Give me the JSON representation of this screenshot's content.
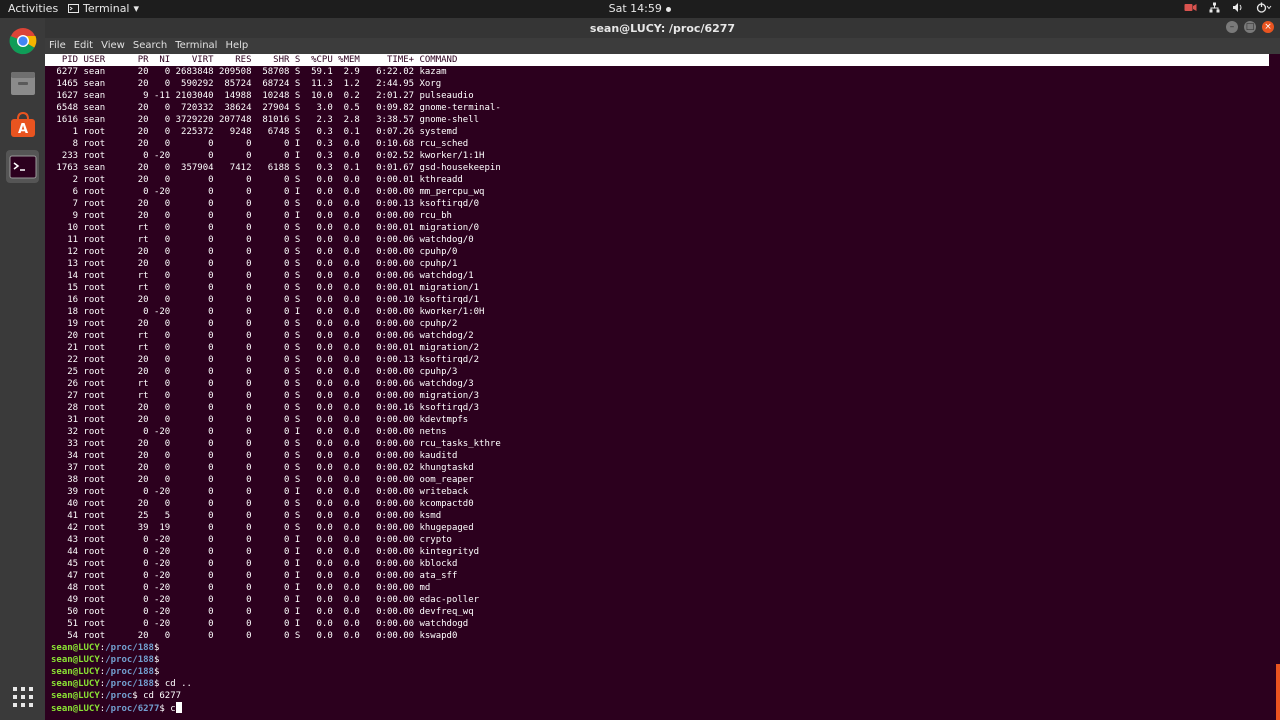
{
  "topbar": {
    "activities": "Activities",
    "app_name": "Terminal",
    "app_arrow": "▾",
    "clock": "Sat 14:59",
    "tray": [
      "video-icon",
      "network-icon",
      "volume-icon",
      "power-icon"
    ]
  },
  "dock": {
    "items": [
      "chrome-icon",
      "files-icon",
      "software-center-icon",
      "terminal-icon",
      "show-apps-icon"
    ]
  },
  "window": {
    "title": "sean@LUCY: /proc/6277",
    "controls": [
      "–",
      "□",
      "×"
    ]
  },
  "menubar": [
    "File",
    "Edit",
    "View",
    "Search",
    "Terminal",
    "Help"
  ],
  "colors": {
    "terminal_bg": "#2c001e",
    "prompt_user": "#8ae234",
    "prompt_path": "#729fcf",
    "accent": "#e95420"
  },
  "top_header": "  PID USER      PR  NI    VIRT    RES    SHR S  %CPU %MEM     TIME+ COMMAND",
  "process_rows": [
    " 6277 sean      20   0 2683848 209508  58708 S  59.1  2.9   6:22.02 kazam",
    " 1465 sean      20   0  590292  85724  68724 S  11.3  1.2   2:44.95 Xorg",
    " 1627 sean       9 -11 2103040  14988  10248 S  10.0  0.2   2:01.27 pulseaudio",
    " 6548 sean      20   0  720332  38624  27904 S   3.0  0.5   0:09.82 gnome-terminal-",
    " 1616 sean      20   0 3729220 207748  81016 S   2.3  2.8   3:38.57 gnome-shell",
    "    1 root      20   0  225372   9248   6748 S   0.3  0.1   0:07.26 systemd",
    "    8 root      20   0       0      0      0 I   0.3  0.0   0:10.68 rcu_sched",
    "  233 root       0 -20       0      0      0 I   0.3  0.0   0:02.52 kworker/1:1H",
    " 1763 sean      20   0  357904   7412   6188 S   0.3  0.1   0:01.67 gsd-housekeepin",
    "    2 root      20   0       0      0      0 S   0.0  0.0   0:00.01 kthreadd",
    "    6 root       0 -20       0      0      0 I   0.0  0.0   0:00.00 mm_percpu_wq",
    "    7 root      20   0       0      0      0 S   0.0  0.0   0:00.13 ksoftirqd/0",
    "    9 root      20   0       0      0      0 I   0.0  0.0   0:00.00 rcu_bh",
    "   10 root      rt   0       0      0      0 S   0.0  0.0   0:00.01 migration/0",
    "   11 root      rt   0       0      0      0 S   0.0  0.0   0:00.06 watchdog/0",
    "   12 root      20   0       0      0      0 S   0.0  0.0   0:00.00 cpuhp/0",
    "   13 root      20   0       0      0      0 S   0.0  0.0   0:00.00 cpuhp/1",
    "   14 root      rt   0       0      0      0 S   0.0  0.0   0:00.06 watchdog/1",
    "   15 root      rt   0       0      0      0 S   0.0  0.0   0:00.01 migration/1",
    "   16 root      20   0       0      0      0 S   0.0  0.0   0:00.10 ksoftirqd/1",
    "   18 root       0 -20       0      0      0 I   0.0  0.0   0:00.00 kworker/1:0H",
    "   19 root      20   0       0      0      0 S   0.0  0.0   0:00.00 cpuhp/2",
    "   20 root      rt   0       0      0      0 S   0.0  0.0   0:00.06 watchdog/2",
    "   21 root      rt   0       0      0      0 S   0.0  0.0   0:00.01 migration/2",
    "   22 root      20   0       0      0      0 S   0.0  0.0   0:00.13 ksoftirqd/2",
    "   25 root      20   0       0      0      0 S   0.0  0.0   0:00.00 cpuhp/3",
    "   26 root      rt   0       0      0      0 S   0.0  0.0   0:00.06 watchdog/3",
    "   27 root      rt   0       0      0      0 S   0.0  0.0   0:00.00 migration/3",
    "   28 root      20   0       0      0      0 S   0.0  0.0   0:00.16 ksoftirqd/3",
    "   31 root      20   0       0      0      0 S   0.0  0.0   0:00.00 kdevtmpfs",
    "   32 root       0 -20       0      0      0 I   0.0  0.0   0:00.00 netns",
    "   33 root      20   0       0      0      0 S   0.0  0.0   0:00.00 rcu_tasks_kthre",
    "   34 root      20   0       0      0      0 S   0.0  0.0   0:00.00 kauditd",
    "   37 root      20   0       0      0      0 S   0.0  0.0   0:00.02 khungtaskd",
    "   38 root      20   0       0      0      0 S   0.0  0.0   0:00.00 oom_reaper",
    "   39 root       0 -20       0      0      0 I   0.0  0.0   0:00.00 writeback",
    "   40 root      20   0       0      0      0 S   0.0  0.0   0:00.00 kcompactd0",
    "   41 root      25   5       0      0      0 S   0.0  0.0   0:00.00 ksmd",
    "   42 root      39  19       0      0      0 S   0.0  0.0   0:00.00 khugepaged",
    "   43 root       0 -20       0      0      0 I   0.0  0.0   0:00.00 crypto",
    "   44 root       0 -20       0      0      0 I   0.0  0.0   0:00.00 kintegrityd",
    "   45 root       0 -20       0      0      0 I   0.0  0.0   0:00.00 kblockd",
    "   47 root       0 -20       0      0      0 I   0.0  0.0   0:00.00 ata_sff",
    "   48 root       0 -20       0      0      0 I   0.0  0.0   0:00.00 md",
    "   49 root       0 -20       0      0      0 I   0.0  0.0   0:00.00 edac-poller",
    "   50 root       0 -20       0      0      0 I   0.0  0.0   0:00.00 devfreq_wq",
    "   51 root       0 -20       0      0      0 I   0.0  0.0   0:00.00 watchdogd",
    "   54 root      20   0       0      0      0 S   0.0  0.0   0:00.00 kswapd0"
  ],
  "prompt_lines": [
    {
      "user": "sean@LUCY",
      "path": "/proc/188",
      "cmd": ""
    },
    {
      "user": "sean@LUCY",
      "path": "/proc/188",
      "cmd": ""
    },
    {
      "user": "sean@LUCY",
      "path": "/proc/188",
      "cmd": ""
    },
    {
      "user": "sean@LUCY",
      "path": "/proc/188",
      "cmd": " cd .."
    },
    {
      "user": "sean@LUCY",
      "path": "/proc",
      "cmd": " cd 6277"
    },
    {
      "user": "sean@LUCY",
      "path": "/proc/6277",
      "cmd": " c"
    }
  ]
}
